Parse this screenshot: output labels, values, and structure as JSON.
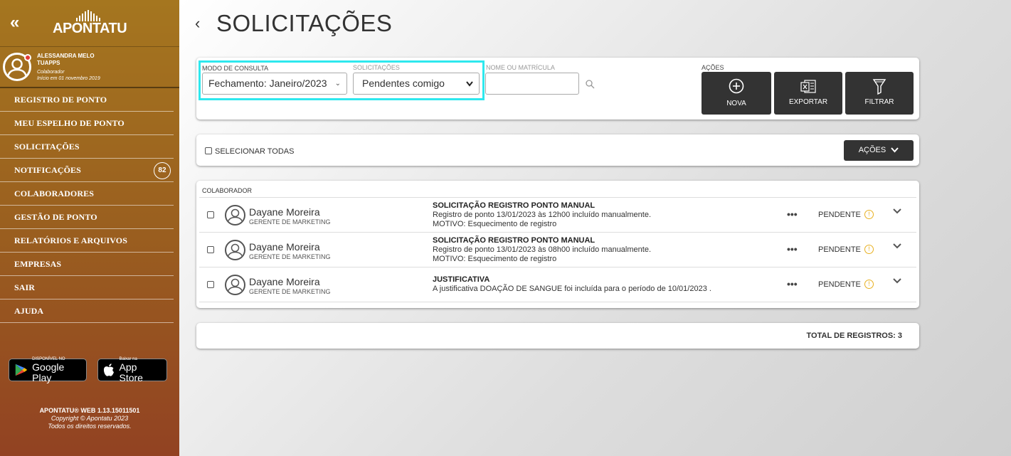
{
  "sidebar": {
    "collapse_glyph": "«",
    "logo": "APONTATU",
    "user": {
      "name": "ALESSANDRA MELO",
      "company": "TUAPPS",
      "role": "Colaborador",
      "since": "Início em 01 novembro 2019"
    },
    "menu": [
      {
        "label": "REGISTRO DE PONTO"
      },
      {
        "label": "MEU ESPELHO DE PONTO"
      },
      {
        "label": "SOLICITAÇÕES"
      },
      {
        "label": "NOTIFICAÇÕES",
        "badge": "82"
      },
      {
        "label": "COLABORADORES"
      },
      {
        "label": "GESTÃO DE PONTO"
      },
      {
        "label": "RELATÓRIOS E ARQUIVOS"
      },
      {
        "label": "EMPRESAS"
      },
      {
        "label": "SAIR"
      },
      {
        "label": "AJUDA"
      }
    ],
    "stores": {
      "google_small": "DISPONÍVEL NO",
      "google_big": "Google Play",
      "apple_small": "Baixar na",
      "apple_big": "App Store"
    },
    "footer": {
      "version": "APONTATU® WEB 1.13.15011501",
      "copyright": "Copyright © Apontatu 2023",
      "rights": "Todos os direitos reservados."
    }
  },
  "page": {
    "back_glyph": "‹",
    "title": "SOLICITAÇÕES"
  },
  "filters": {
    "mode_label": "MODO DE CONSULTA",
    "mode_value": "Fechamento: Janeiro/2023",
    "requests_label": "SOLICITAÇÕES",
    "requests_value": "Pendentes comigo",
    "name_label": "NOME OU MATRÍCULA",
    "name_value": "",
    "actions_label": "AÇÕES",
    "buttons": {
      "new": "NOVA",
      "export": "EXPORTAR",
      "filter": "FILTRAR"
    }
  },
  "selection": {
    "select_all": "SELECIONAR TODAS",
    "actions_dropdown": "AÇÕES"
  },
  "list": {
    "column_header": "COLABORADOR",
    "rows": [
      {
        "name": "Dayane Moreira",
        "role": "GERENTE DE MARKETING",
        "title": "SOLICITAÇÃO REGISTRO PONTO MANUAL",
        "line1": "Registro de ponto 13/01/2023 às 12h00 incluído manualmente.",
        "line2": "MOTIVO: Esquecimento de registro",
        "status": "PENDENTE"
      },
      {
        "name": "Dayane Moreira",
        "role": "GERENTE DE MARKETING",
        "title": "SOLICITAÇÃO REGISTRO PONTO MANUAL",
        "line1": "Registro de ponto 13/01/2023 às 08h00 incluído manualmente.",
        "line2": "MOTIVO: Esquecimento de registro",
        "status": "PENDENTE"
      },
      {
        "name": "Dayane Moreira",
        "role": "GERENTE DE MARKETING",
        "title": "JUSTIFICATIVA",
        "line1": "A justificativa DOAÇÃO DE SANGUE foi incluída para o período de 10/01/2023 .",
        "line2": "",
        "status": "PENDENTE"
      }
    ],
    "more_glyph": "•••",
    "info_glyph": "!"
  },
  "total": {
    "label": "TOTAL DE REGISTROS: 3"
  }
}
